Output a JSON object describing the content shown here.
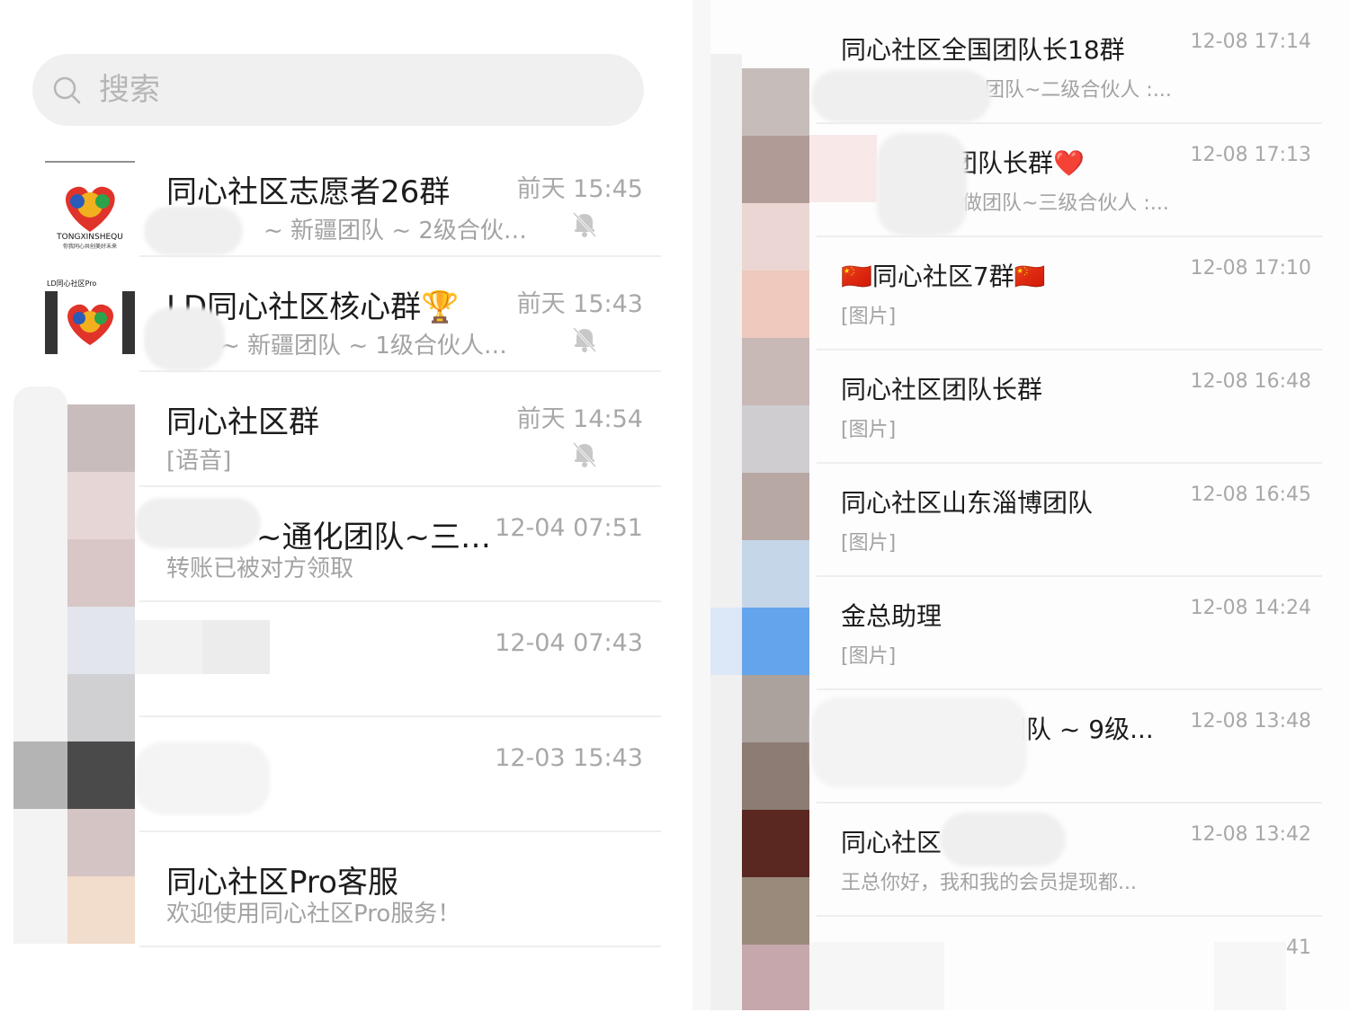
{
  "search": {
    "placeholder": "搜索",
    "icon": "search-icon"
  },
  "left_chats": [
    {
      "title": "同心社区志愿者26群",
      "preview": "~ 新疆团队 ~ 2级合伙…",
      "time": "前天 15:45",
      "muted": true,
      "avatar": "tongxin-logo"
    },
    {
      "title": "LD同心社区核心群🏆",
      "preview": "~ 新疆团队 ~ 1级合伙人…",
      "time": "前天 15:43",
      "muted": true,
      "avatar": "ld-tongxin-logo"
    },
    {
      "title": "同心社区群",
      "preview": "[语音]",
      "time": "前天 14:54",
      "muted": true,
      "avatar": "blurred"
    },
    {
      "title": "~通化团队~三…",
      "preview": "转账已被对方领取",
      "time": "12-04 07:51",
      "muted": false,
      "avatar": "blurred"
    },
    {
      "title": "",
      "preview": "",
      "time": "12-04 07:43",
      "muted": false,
      "avatar": "blurred"
    },
    {
      "title": "",
      "preview": "",
      "time": "12-03 15:43",
      "muted": false,
      "avatar": "blurred"
    },
    {
      "title": "同心社区Pro客服",
      "preview": "欢迎使用同心社区Pro服务！",
      "time": "",
      "muted": false,
      "avatar": "blurred"
    }
  ],
  "right_chats": [
    {
      "title": "同心社区全国团队长18群",
      "preview": "团队~二级合伙人 :...",
      "time": "12-08 17:14"
    },
    {
      "title": "做团队长群❤️",
      "preview": "做团队~三级合伙人 :...",
      "time": "12-08 17:13"
    },
    {
      "title": "🇨🇳同心社区7群🇨🇳",
      "preview": "[图片]",
      "time": "12-08 17:10"
    },
    {
      "title": "同心社区团队长群",
      "preview": "[图片]",
      "time": "12-08 16:48"
    },
    {
      "title": "同心社区山东淄博团队",
      "preview": "[图片]",
      "time": "12-08 16:45"
    },
    {
      "title": "金总助理",
      "preview": "[图片]",
      "time": "12-08 14:24"
    },
    {
      "title": "做团队 ~ 9级...",
      "preview": "",
      "time": "12-08 13:48"
    },
    {
      "title": "同心社区",
      "preview": "王总你好，我和我的会员提现都...",
      "time": "12-08 13:42"
    },
    {
      "title": "",
      "preview": "",
      "time": "41"
    }
  ],
  "logos": {
    "logo1_text": "TONGXINSHEQU",
    "logo1_sub": "你我同心共创美好未来",
    "logo2_text": "LD同心社区Pro"
  },
  "colors": {
    "accent_red": "#e0332a",
    "muted_gray": "#a8a8a8"
  }
}
